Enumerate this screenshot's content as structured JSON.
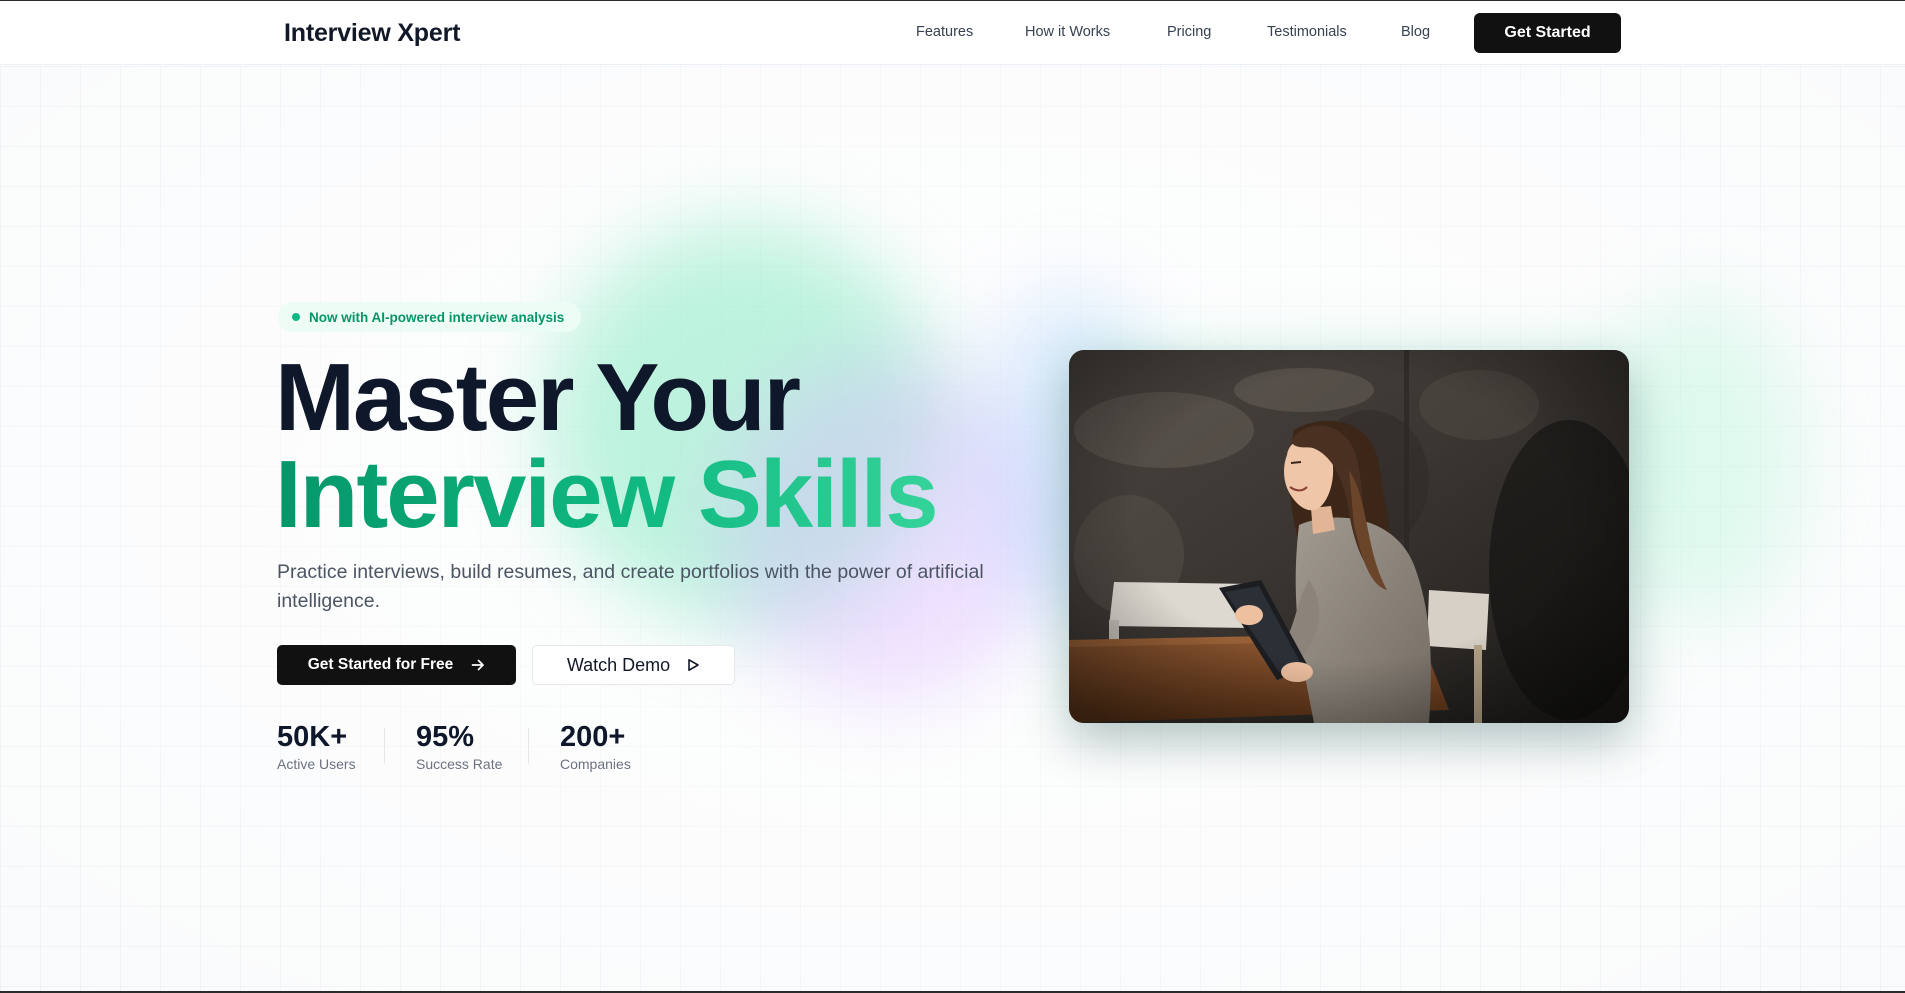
{
  "header": {
    "logo": "Interview Xpert",
    "nav": [
      {
        "label": "Features"
      },
      {
        "label": "How it Works"
      },
      {
        "label": "Pricing"
      },
      {
        "label": "Testimonials"
      },
      {
        "label": "Blog"
      }
    ],
    "cta_label": "Get Started"
  },
  "hero": {
    "badge": "Now with AI-powered interview analysis",
    "title_line1": "Master Your",
    "title_line2": "Interview Skills",
    "subtitle": "Practice interviews, build resumes, and create portfolios with the power of artificial intelligence.",
    "primary_cta": "Get Started for Free",
    "secondary_cta": "Watch Demo",
    "stats": [
      {
        "value": "50K+",
        "label": "Active Users"
      },
      {
        "value": "95%",
        "label": "Success Rate"
      },
      {
        "value": "200+",
        "label": "Companies"
      }
    ],
    "image_subject": "smiling woman holding a tablet at a wooden table"
  },
  "icons": {
    "primary_cta_icon": "arrow-right-icon",
    "secondary_cta_icon": "play-icon",
    "badge_icon": "status-dot"
  },
  "colors": {
    "accent_green": "#10b981",
    "accent_green_dark": "#059669",
    "dark": "#111111",
    "text_dark": "#0f172a",
    "text_muted": "#4b5563"
  }
}
